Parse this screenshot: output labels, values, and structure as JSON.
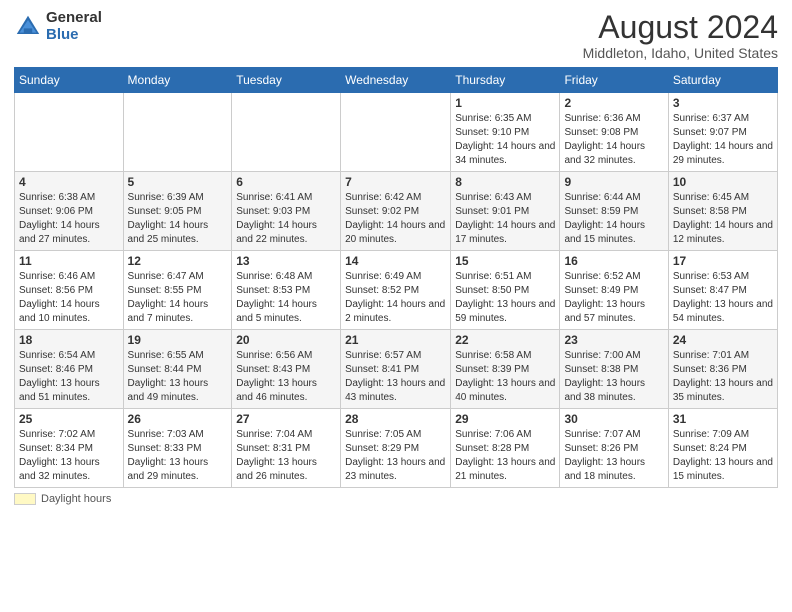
{
  "logo": {
    "general": "General",
    "blue": "Blue"
  },
  "title": "August 2024",
  "subtitle": "Middleton, Idaho, United States",
  "footer": {
    "swatch_label": "Daylight hours"
  },
  "weekdays": [
    "Sunday",
    "Monday",
    "Tuesday",
    "Wednesday",
    "Thursday",
    "Friday",
    "Saturday"
  ],
  "weeks": [
    [
      {
        "day": "",
        "info": ""
      },
      {
        "day": "",
        "info": ""
      },
      {
        "day": "",
        "info": ""
      },
      {
        "day": "",
        "info": ""
      },
      {
        "day": "1",
        "info": "Sunrise: 6:35 AM\nSunset: 9:10 PM\nDaylight: 14 hours and 34 minutes."
      },
      {
        "day": "2",
        "info": "Sunrise: 6:36 AM\nSunset: 9:08 PM\nDaylight: 14 hours and 32 minutes."
      },
      {
        "day": "3",
        "info": "Sunrise: 6:37 AM\nSunset: 9:07 PM\nDaylight: 14 hours and 29 minutes."
      }
    ],
    [
      {
        "day": "4",
        "info": "Sunrise: 6:38 AM\nSunset: 9:06 PM\nDaylight: 14 hours and 27 minutes."
      },
      {
        "day": "5",
        "info": "Sunrise: 6:39 AM\nSunset: 9:05 PM\nDaylight: 14 hours and 25 minutes."
      },
      {
        "day": "6",
        "info": "Sunrise: 6:41 AM\nSunset: 9:03 PM\nDaylight: 14 hours and 22 minutes."
      },
      {
        "day": "7",
        "info": "Sunrise: 6:42 AM\nSunset: 9:02 PM\nDaylight: 14 hours and 20 minutes."
      },
      {
        "day": "8",
        "info": "Sunrise: 6:43 AM\nSunset: 9:01 PM\nDaylight: 14 hours and 17 minutes."
      },
      {
        "day": "9",
        "info": "Sunrise: 6:44 AM\nSunset: 8:59 PM\nDaylight: 14 hours and 15 minutes."
      },
      {
        "day": "10",
        "info": "Sunrise: 6:45 AM\nSunset: 8:58 PM\nDaylight: 14 hours and 12 minutes."
      }
    ],
    [
      {
        "day": "11",
        "info": "Sunrise: 6:46 AM\nSunset: 8:56 PM\nDaylight: 14 hours and 10 minutes."
      },
      {
        "day": "12",
        "info": "Sunrise: 6:47 AM\nSunset: 8:55 PM\nDaylight: 14 hours and 7 minutes."
      },
      {
        "day": "13",
        "info": "Sunrise: 6:48 AM\nSunset: 8:53 PM\nDaylight: 14 hours and 5 minutes."
      },
      {
        "day": "14",
        "info": "Sunrise: 6:49 AM\nSunset: 8:52 PM\nDaylight: 14 hours and 2 minutes."
      },
      {
        "day": "15",
        "info": "Sunrise: 6:51 AM\nSunset: 8:50 PM\nDaylight: 13 hours and 59 minutes."
      },
      {
        "day": "16",
        "info": "Sunrise: 6:52 AM\nSunset: 8:49 PM\nDaylight: 13 hours and 57 minutes."
      },
      {
        "day": "17",
        "info": "Sunrise: 6:53 AM\nSunset: 8:47 PM\nDaylight: 13 hours and 54 minutes."
      }
    ],
    [
      {
        "day": "18",
        "info": "Sunrise: 6:54 AM\nSunset: 8:46 PM\nDaylight: 13 hours and 51 minutes."
      },
      {
        "day": "19",
        "info": "Sunrise: 6:55 AM\nSunset: 8:44 PM\nDaylight: 13 hours and 49 minutes."
      },
      {
        "day": "20",
        "info": "Sunrise: 6:56 AM\nSunset: 8:43 PM\nDaylight: 13 hours and 46 minutes."
      },
      {
        "day": "21",
        "info": "Sunrise: 6:57 AM\nSunset: 8:41 PM\nDaylight: 13 hours and 43 minutes."
      },
      {
        "day": "22",
        "info": "Sunrise: 6:58 AM\nSunset: 8:39 PM\nDaylight: 13 hours and 40 minutes."
      },
      {
        "day": "23",
        "info": "Sunrise: 7:00 AM\nSunset: 8:38 PM\nDaylight: 13 hours and 38 minutes."
      },
      {
        "day": "24",
        "info": "Sunrise: 7:01 AM\nSunset: 8:36 PM\nDaylight: 13 hours and 35 minutes."
      }
    ],
    [
      {
        "day": "25",
        "info": "Sunrise: 7:02 AM\nSunset: 8:34 PM\nDaylight: 13 hours and 32 minutes."
      },
      {
        "day": "26",
        "info": "Sunrise: 7:03 AM\nSunset: 8:33 PM\nDaylight: 13 hours and 29 minutes."
      },
      {
        "day": "27",
        "info": "Sunrise: 7:04 AM\nSunset: 8:31 PM\nDaylight: 13 hours and 26 minutes."
      },
      {
        "day": "28",
        "info": "Sunrise: 7:05 AM\nSunset: 8:29 PM\nDaylight: 13 hours and 23 minutes."
      },
      {
        "day": "29",
        "info": "Sunrise: 7:06 AM\nSunset: 8:28 PM\nDaylight: 13 hours and 21 minutes."
      },
      {
        "day": "30",
        "info": "Sunrise: 7:07 AM\nSunset: 8:26 PM\nDaylight: 13 hours and 18 minutes."
      },
      {
        "day": "31",
        "info": "Sunrise: 7:09 AM\nSunset: 8:24 PM\nDaylight: 13 hours and 15 minutes."
      }
    ]
  ]
}
